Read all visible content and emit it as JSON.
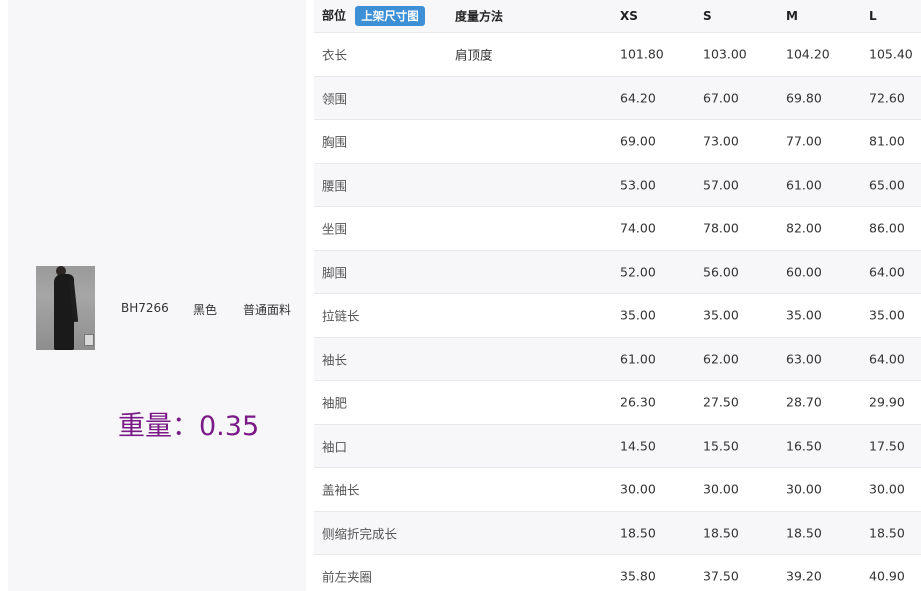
{
  "product": {
    "code": "BH7266",
    "color": "黑色",
    "fabric": "普通面料",
    "weight": "重量：0.35",
    "thumbnail": "dress-photo"
  },
  "table": {
    "header": {
      "part": "部位",
      "button": "上架尺寸图",
      "method": "度量方法",
      "sizes": [
        "XS",
        "S",
        "M",
        "L"
      ]
    },
    "rows": [
      {
        "part": "衣长",
        "method": "肩顶度",
        "values": [
          "101.80",
          "103.00",
          "104.20",
          "105.40"
        ]
      },
      {
        "part": "领围",
        "method": "",
        "values": [
          "64.20",
          "67.00",
          "69.80",
          "72.60"
        ]
      },
      {
        "part": "胸围",
        "method": "",
        "values": [
          "69.00",
          "73.00",
          "77.00",
          "81.00"
        ]
      },
      {
        "part": "腰围",
        "method": "",
        "values": [
          "53.00",
          "57.00",
          "61.00",
          "65.00"
        ]
      },
      {
        "part": "坐围",
        "method": "",
        "values": [
          "74.00",
          "78.00",
          "82.00",
          "86.00"
        ]
      },
      {
        "part": "脚围",
        "method": "",
        "values": [
          "52.00",
          "56.00",
          "60.00",
          "64.00"
        ]
      },
      {
        "part": "拉链长",
        "method": "",
        "values": [
          "35.00",
          "35.00",
          "35.00",
          "35.00"
        ]
      },
      {
        "part": "袖长",
        "method": "",
        "values": [
          "61.00",
          "62.00",
          "63.00",
          "64.00"
        ]
      },
      {
        "part": "袖肥",
        "method": "",
        "values": [
          "26.30",
          "27.50",
          "28.70",
          "29.90"
        ]
      },
      {
        "part": "袖口",
        "method": "",
        "values": [
          "14.50",
          "15.50",
          "16.50",
          "17.50"
        ]
      },
      {
        "part": "盖袖长",
        "method": "",
        "values": [
          "30.00",
          "30.00",
          "30.00",
          "30.00"
        ]
      },
      {
        "part": "侧缩折完成长",
        "method": "",
        "values": [
          "18.50",
          "18.50",
          "18.50",
          "18.50"
        ]
      },
      {
        "part": "前左夹圈",
        "method": "",
        "values": [
          "35.80",
          "37.50",
          "39.20",
          "40.90"
        ]
      }
    ]
  },
  "colors": {
    "weight_text": "#7a1a86",
    "button_bg": "#3d8fd6",
    "panel_bg": "#f7f7f9"
  }
}
